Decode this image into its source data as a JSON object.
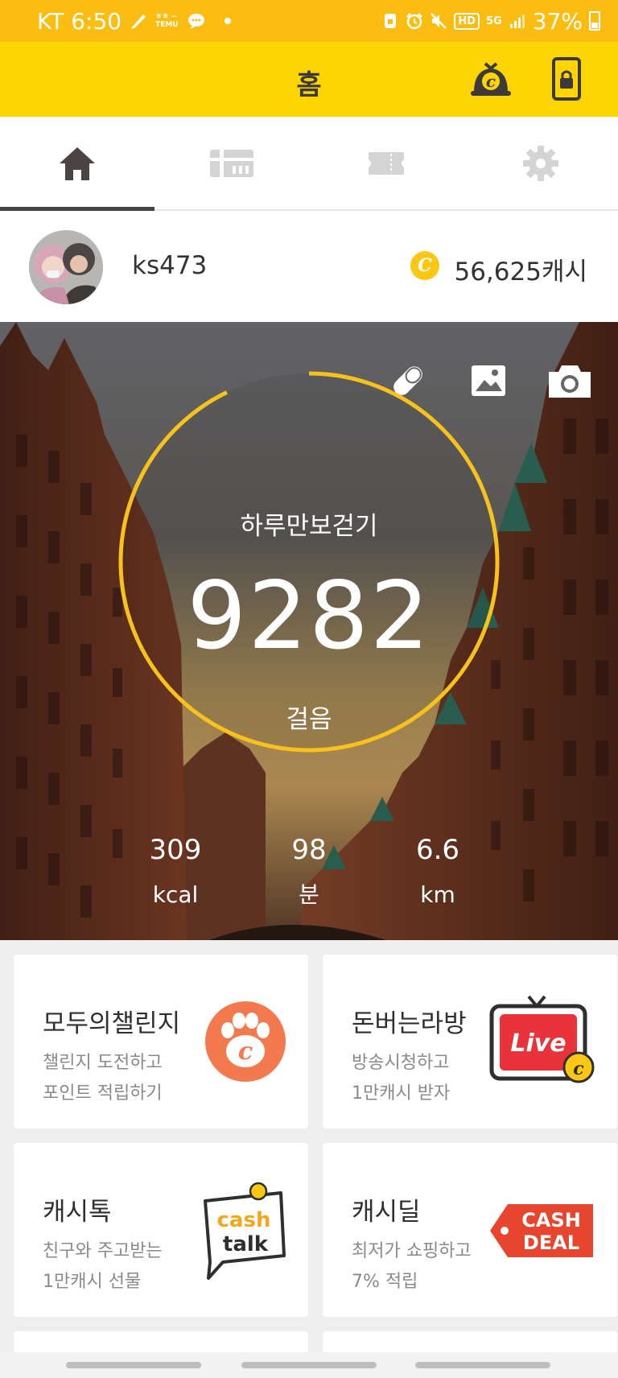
{
  "status_bar": {
    "carrier_time": "KT 6:50",
    "notif_text": "ㅎㅎ ~ TEMU",
    "hd_badge": "HD",
    "network": "5G",
    "battery": "37%"
  },
  "header": {
    "title": "홈"
  },
  "tabs": [
    {
      "name": "home",
      "icon": "home-icon",
      "active": true
    },
    {
      "name": "gift",
      "icon": "gift-card-icon",
      "active": false
    },
    {
      "name": "ticket",
      "icon": "ticket-icon",
      "active": false
    },
    {
      "name": "settings",
      "icon": "gear-icon",
      "active": false
    }
  ],
  "profile": {
    "username": "ks473",
    "coin_symbol": "C",
    "cash": "56,625캐시"
  },
  "pedometer": {
    "title": "하루만보걷기",
    "steps": "9282",
    "unit": "걸음",
    "progress": 0.928,
    "ring_color": "#f6c21b"
  },
  "stats": [
    {
      "value": "309",
      "unit": "kcal"
    },
    {
      "value": "98",
      "unit": "분"
    },
    {
      "value": "6.6",
      "unit": "km"
    }
  ],
  "cards": [
    {
      "title": "모두의챌린지",
      "line1": "챌린지 도전하고",
      "line2": "포인트 적립하기",
      "art": "paw-coin"
    },
    {
      "title": "돈버는라방",
      "line1": "방송시청하고",
      "line2": "1만캐시 받자",
      "art": "live-tv",
      "art_text": "Live"
    },
    {
      "title": "캐시톡",
      "line1": "친구와 주고받는",
      "line2": "1만캐시 선물",
      "art": "cash-talk",
      "art_text_1": "cash",
      "art_text_2": "talk"
    },
    {
      "title": "캐시딜",
      "line1": "최저가 쇼핑하고",
      "line2": "7% 적립",
      "art": "cash-deal",
      "art_text_1": "CASH",
      "art_text_2": "DEAL"
    }
  ],
  "colors": {
    "status_bar": "#fbbd12",
    "header": "#fdd505",
    "accent_coin": "#fcc614",
    "paw_badge": "#f37a4f",
    "live_red": "#e8333a",
    "deal_red": "#e8452f"
  }
}
